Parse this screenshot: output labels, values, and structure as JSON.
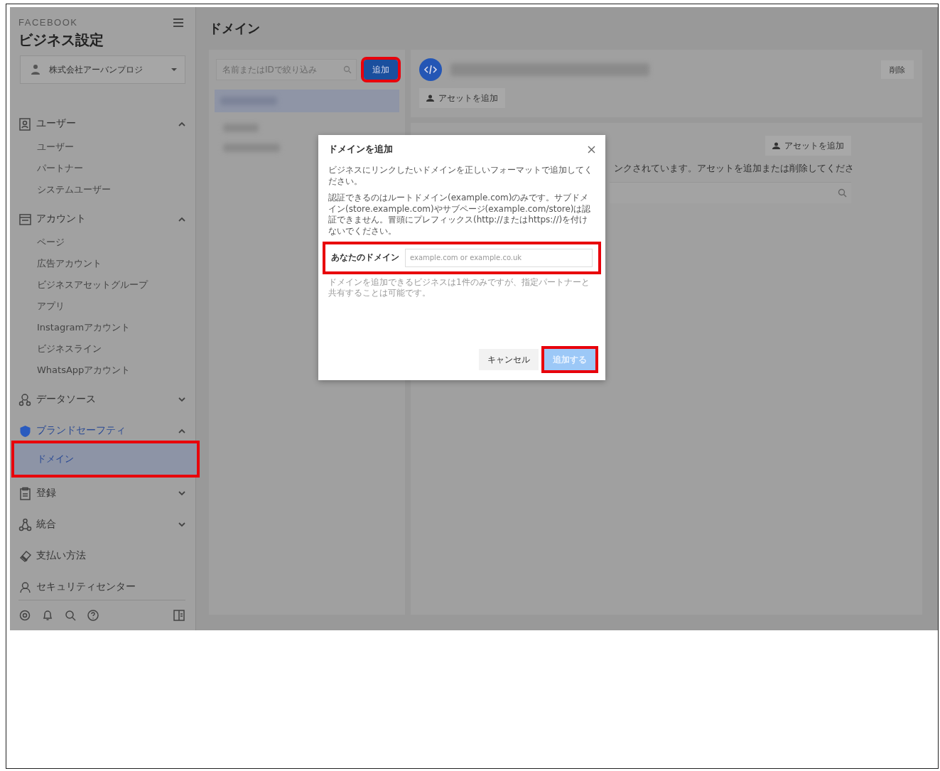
{
  "sidebar": {
    "brand": "FACEBOOK",
    "title": "ビジネス設定",
    "business": "株式会社アーバンプロジ",
    "sections": [
      {
        "kind": "users",
        "label": "ユーザー",
        "expanded": true,
        "selected": false,
        "children": [
          {
            "label": "ユーザー",
            "selected": false,
            "highlighted": false
          },
          {
            "label": "パートナー",
            "selected": false,
            "highlighted": false
          },
          {
            "label": "システムユーザー",
            "selected": false,
            "highlighted": false
          }
        ]
      },
      {
        "kind": "accounts",
        "label": "アカウント",
        "expanded": true,
        "selected": false,
        "children": [
          {
            "label": "ページ",
            "selected": false,
            "highlighted": false
          },
          {
            "label": "広告アカウント",
            "selected": false,
            "highlighted": false
          },
          {
            "label": "ビジネスアセットグループ",
            "selected": false,
            "highlighted": false
          },
          {
            "label": "アプリ",
            "selected": false,
            "highlighted": false
          },
          {
            "label": "Instagramアカウント",
            "selected": false,
            "highlighted": false
          },
          {
            "label": "ビジネスライン",
            "selected": false,
            "highlighted": false
          },
          {
            "label": "WhatsAppアカウント",
            "selected": false,
            "highlighted": false
          }
        ]
      },
      {
        "kind": "datasource",
        "label": "データソース",
        "expanded": false,
        "selected": false
      },
      {
        "kind": "brandsafety",
        "label": "ブランドセーフティ",
        "expanded": true,
        "selected": true,
        "children": [
          {
            "label": "ドメイン",
            "selected": true,
            "highlighted": true
          }
        ]
      },
      {
        "kind": "registration",
        "label": "登録",
        "expanded": false,
        "selected": false
      },
      {
        "kind": "integration",
        "label": "統合",
        "expanded": false,
        "selected": false
      },
      {
        "kind": "payment",
        "label": "支払い方法",
        "selected": false
      },
      {
        "kind": "security",
        "label": "セキュリティセンター",
        "selected": false
      }
    ]
  },
  "page": {
    "title": "ドメイン"
  },
  "list_panel": {
    "search": {
      "placeholder": "名前またはIDで絞り込み"
    },
    "add_button": {
      "label": "追加",
      "highlighted": true
    },
    "items": [
      {
        "selected": true
      },
      {
        "selected": false
      },
      {
        "selected": false
      }
    ]
  },
  "detail": {
    "delete_button": "削除",
    "add_asset_button": "アセットを追加",
    "assets": {
      "add_asset_button": "アセットを追加",
      "description": "ンクされています。アセットを追加または削除してくださ"
    }
  },
  "dialog": {
    "title": "ドメインを追加",
    "intro": "ビジネスにリンクしたいドメインを正しいフォーマットで追加してください。",
    "rules": "認証できるのはルートドメイン(example.com)のみです。サブドメイン(store.example.com)やサブページ(example.com/store)は認証できません。冒頭にプレフィックス(http://またはhttps://)を付けないでください。",
    "field": {
      "label": "あなたのドメイン",
      "placeholder": "example.com or example.co.uk",
      "highlighted": true
    },
    "note": "ドメインを追加できるビジネスは1件のみですが、指定パートナーと共有することは可能です。",
    "cancel_button": "キャンセル",
    "submit_button": {
      "label": "追加する",
      "disabled": true,
      "highlighted": true
    }
  }
}
